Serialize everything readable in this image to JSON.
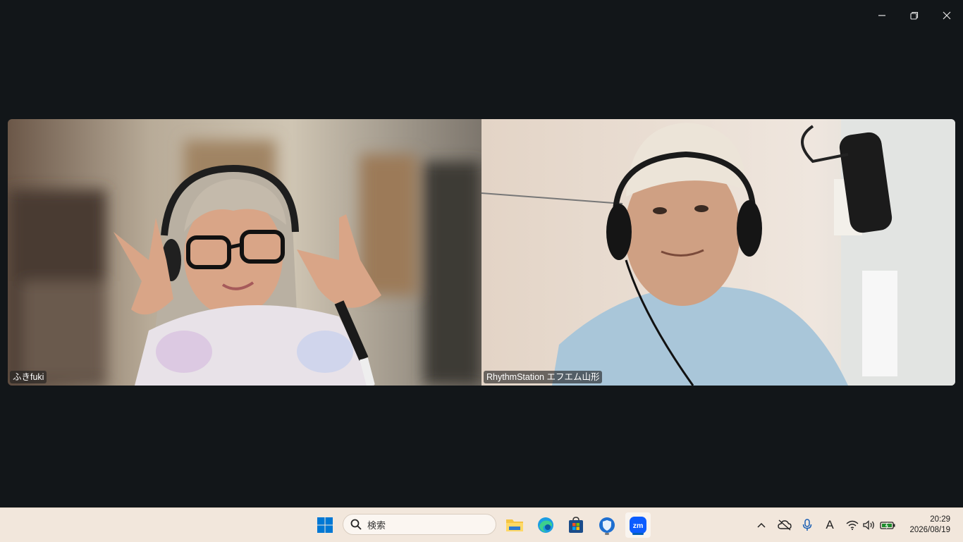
{
  "window": {
    "controls": {
      "minimize": "minimize-icon",
      "restore": "restore-icon",
      "close": "close-icon"
    }
  },
  "participants": [
    {
      "name": "ふきfuki"
    },
    {
      "name": "RhythmStation エフエム山形"
    }
  ],
  "taskbar": {
    "search_placeholder": "検索",
    "apps": [
      "windows-start-icon",
      "file-explorer-icon",
      "edge-icon",
      "store-icon",
      "security-icon",
      "zoom-icon"
    ],
    "tray_icons": [
      "chevron-up-icon",
      "cloud-off-icon",
      "microphone-icon",
      "ime-icon",
      "wifi-icon",
      "volume-icon",
      "battery-icon"
    ],
    "ime_label": "A",
    "time": "20:29",
    "date": "2026/08/19"
  },
  "colors": {
    "background": "#121619",
    "taskbar": "#f2e7dc",
    "accent": "#005fb8"
  }
}
